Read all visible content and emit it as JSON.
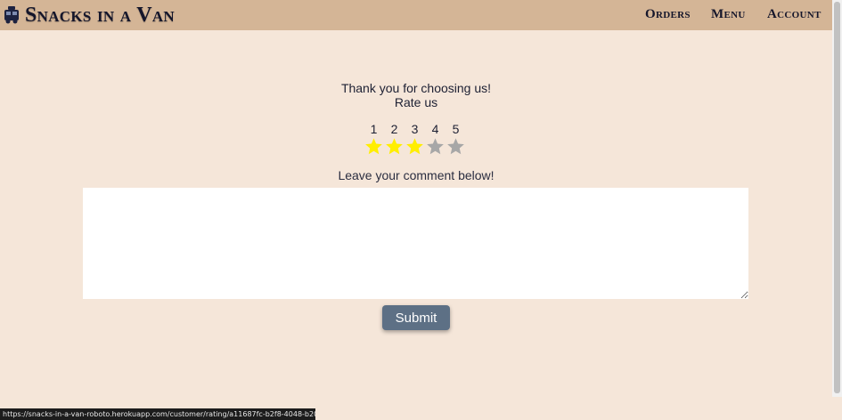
{
  "header": {
    "brand": "Snacks in a Van",
    "brand_icon": "van-icon",
    "nav": [
      "Orders",
      "Menu",
      "Account"
    ]
  },
  "main": {
    "thanks": "Thank you for choosing us!",
    "rate_label": "Rate us",
    "rating": {
      "labels": [
        "1",
        "2",
        "3",
        "4",
        "5"
      ],
      "selected": 3,
      "filled_color": "#ffee00",
      "empty_color": "#a7a7a7",
      "star_icon": "star-icon"
    },
    "comment_label": "Leave your comment below!",
    "comment_value": "",
    "submit_label": "Submit"
  },
  "status_url": "https://snacks-in-a-van-roboto.herokuapp.com/customer/rating/a11687fc-b2f8-4048-b203-b1e38ce5e2e6#",
  "colors": {
    "navbar": "#d4b596",
    "page_bg": "#f5e6d9",
    "button": "#5d7085"
  }
}
